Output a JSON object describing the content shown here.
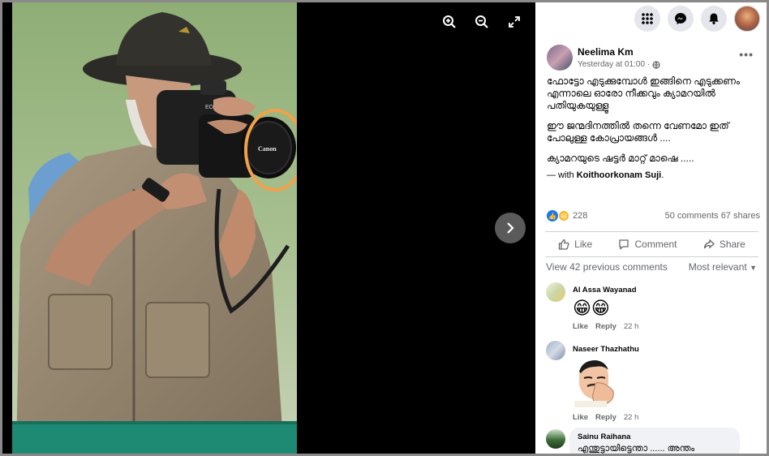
{
  "viewer": {
    "tools": [
      "zoom-in-icon",
      "zoom-out-icon",
      "fullscreen-icon"
    ],
    "next_icon": "chevron-right-icon",
    "camera_brand": "Canon"
  },
  "topbar": {
    "icons": [
      "menu-grid-icon",
      "messenger-icon",
      "notifications-bell-icon"
    ]
  },
  "post": {
    "author": "Neelima Km",
    "time": "Yesterday at 01:00 ·",
    "audience_icon": "globe-icon",
    "more": "•••",
    "paragraphs": [
      "ഫോട്ടോ എടുക്കുമ്പോൾ ഇങ്ങിനെ എടുക്കണം എന്നാലെ ഓരോ നീക്കവും ക്യാമറയിൽ പതിയുകയുള്ളൂ",
      "ഈ ജന്മദിനത്തിൽ തന്നെ വേണമോ ഇത് പോലുള്ള കോപ്രായങ്ങൾ ....",
      "ക്യാമറയുടെ ഷട്ടർ മാറ്റ് മാഷെ ....."
    ],
    "with_prefix": "— with",
    "with_name": "Koithoorkonam Suji",
    "with_suffix": "."
  },
  "stats": {
    "reaction_count": "228",
    "comments": "50 comments",
    "shares": "67 shares"
  },
  "actions": {
    "like": "Like",
    "comment": "Comment",
    "share": "Share"
  },
  "comments_bar": {
    "previous": "View 42 previous comments",
    "sort": "Most relevant"
  },
  "comments": [
    {
      "name": "Al Assa Wayanad",
      "body": "😁😁",
      "like": "Like",
      "reply": "Reply",
      "time": "22 h"
    },
    {
      "name": "Naseer Thazhathu",
      "body": "",
      "like": "Like",
      "reply": "Reply",
      "time": "22 h"
    },
    {
      "name": "Sainu Raihana",
      "body": "എന്തുട്ടായിട്ടെന്താ ...... അന്തം"
    }
  ],
  "colors": {
    "accent": "#1877f2",
    "highlight_circle": "#f0a24a",
    "secondary_text": "#65676b"
  }
}
